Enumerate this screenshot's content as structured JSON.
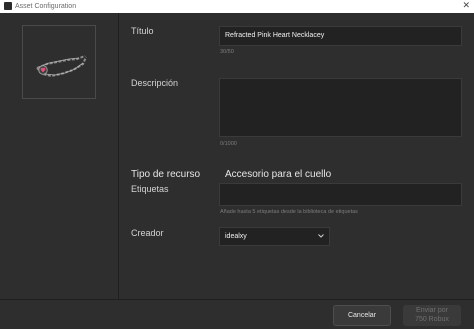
{
  "window": {
    "title": "Asset Configuration",
    "close_glyph": "✕"
  },
  "form": {
    "titulo_label": "Título",
    "titulo_value": "Refracted Pink Heart Necklacey",
    "titulo_count": "30/50",
    "descripcion_label": "Descripción",
    "descripcion_value": "",
    "descripcion_count": "0/1000",
    "tipo_label": "Tipo de recurso",
    "tipo_value": "Accesorio para el cuello",
    "etiquetas_label": "Etiquetas",
    "etiquetas_value": "",
    "etiquetas_hint": "Añade hasta 5 etiquetas desde la biblioteca de etiquetas",
    "creador_label": "Creador",
    "creador_value": "idealxy"
  },
  "footer": {
    "cancel_label": "Cancelar",
    "send_line1": "Enviar por",
    "send_line2": "750 Robux"
  },
  "icons": {
    "app": "app-icon",
    "close": "close-icon",
    "dropdown": "chevron-down-icon",
    "thumbnail": "necklace-thumbnail"
  },
  "colors": {
    "background": "#2e2e2e",
    "field": "#222222",
    "accent_pink": "#e0507a"
  }
}
